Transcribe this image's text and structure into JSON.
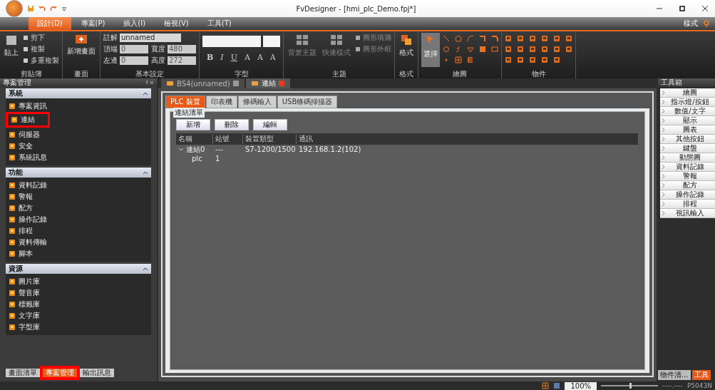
{
  "window": {
    "title": "FvDesigner - [hmi_plc_Demo.fpj*]"
  },
  "menu_tabs": [
    {
      "label": "設計(D)",
      "selected": true
    },
    {
      "label": "專案(P)",
      "selected": false
    },
    {
      "label": "插入(I)",
      "selected": false
    },
    {
      "label": "檢視(V)",
      "selected": false
    },
    {
      "label": "工具(T)",
      "selected": false
    }
  ],
  "style_menu": "樣式",
  "ribbon": {
    "clipboard": {
      "label": "剪貼簿",
      "paste": "貼上",
      "actions": [
        "剪下",
        "複製",
        "多重複製"
      ]
    },
    "screen": {
      "label": "畫面",
      "new_screen": "新增畫面"
    },
    "basic": {
      "label": "基本設定",
      "note_label": "註解",
      "note_value": "unnamed",
      "fields": [
        {
          "label": "頂端",
          "value": "0"
        },
        {
          "label": "寬度",
          "value": "480"
        },
        {
          "label": "左邊",
          "value": "0"
        },
        {
          "label": "高度",
          "value": "272"
        }
      ]
    },
    "font": {
      "label": "字型",
      "buttons": [
        "B",
        "I",
        "U",
        "A",
        "A",
        "A"
      ]
    },
    "theme": {
      "label": "主題",
      "buttons": [
        "背景主題",
        "快速樣式"
      ],
      "menus": [
        "圖形填滿",
        "圖形外框"
      ]
    },
    "format": {
      "label": "格式",
      "button": "格式"
    },
    "draw": {
      "label": "繪圖",
      "select": "選擇"
    },
    "objects": {
      "label": "物件"
    }
  },
  "project_panel": {
    "title": "專案管理",
    "sections": [
      {
        "title": "系統",
        "expanded": true,
        "items": [
          {
            "label": "專案資訊",
            "highlighted": false
          },
          {
            "label": "連結",
            "highlighted": true
          },
          {
            "label": "伺服器",
            "highlighted": false
          },
          {
            "label": "安全",
            "highlighted": false
          },
          {
            "label": "系統訊息",
            "highlighted": false
          }
        ]
      },
      {
        "title": "功能",
        "expanded": true,
        "items": [
          {
            "label": "資料記錄",
            "highlighted": false
          },
          {
            "label": "警報",
            "highlighted": false
          },
          {
            "label": "配方",
            "highlighted": false
          },
          {
            "label": "操作記錄",
            "highlighted": false
          },
          {
            "label": "排程",
            "highlighted": false
          },
          {
            "label": "資料傳輸",
            "highlighted": false
          },
          {
            "label": "腳本",
            "highlighted": false
          }
        ]
      },
      {
        "title": "資源",
        "expanded": true,
        "items": [
          {
            "label": "圖片庫",
            "highlighted": false
          },
          {
            "label": "聲音庫",
            "highlighted": false
          },
          {
            "label": "標籤庫",
            "highlighted": false
          },
          {
            "label": "文字庫",
            "highlighted": false
          },
          {
            "label": "字型庫",
            "highlighted": false
          }
        ]
      }
    ],
    "bottom_tabs": [
      {
        "label": "畫面清單",
        "selected": false,
        "highlighted": false
      },
      {
        "label": "專案管理",
        "selected": true,
        "highlighted": true
      },
      {
        "label": "輸出訊息",
        "selected": false,
        "highlighted": false
      }
    ]
  },
  "doc_tabs": [
    {
      "label": "BS4(unnamed)",
      "selected": false
    },
    {
      "label": "連結",
      "selected": true
    }
  ],
  "device_tabs": [
    {
      "label": "PLC 裝置",
      "selected": true
    },
    {
      "label": "印表機",
      "selected": false
    },
    {
      "label": "條碼輸入",
      "selected": false
    },
    {
      "label": "USB條碼掃描器",
      "selected": false
    }
  ],
  "connection_list": {
    "title": "連結清單",
    "buttons": [
      "新增",
      "刪除",
      "編輯"
    ],
    "columns": [
      "名稱",
      "站號",
      "裝置類型",
      "通訊"
    ],
    "rows": [
      {
        "cells": [
          "連結0",
          "---",
          "S7-1200/1500",
          "192.168.1.2(102)"
        ],
        "expanded": true,
        "children": [
          {
            "cells": [
              "plc",
              "1"
            ]
          }
        ]
      }
    ]
  },
  "toolbox": {
    "title": "工具箱",
    "items": [
      "繪圖",
      "指示燈/按鈕",
      "數值/文字",
      "顯示",
      "圖表",
      "其他按鈕",
      "鍵盤",
      "動態圖",
      "資料記錄",
      "警報",
      "配方",
      "操作記錄",
      "排程",
      "視訊輸入"
    ],
    "bottom_tabs": [
      {
        "label": "物件清...",
        "selected": false
      },
      {
        "label": "工具",
        "selected": true
      }
    ]
  },
  "status_bar": {
    "zoom": "100%",
    "zoom_slider": {
      "level": 0.5
    },
    "coords": "----.----",
    "model": "P5043N"
  }
}
